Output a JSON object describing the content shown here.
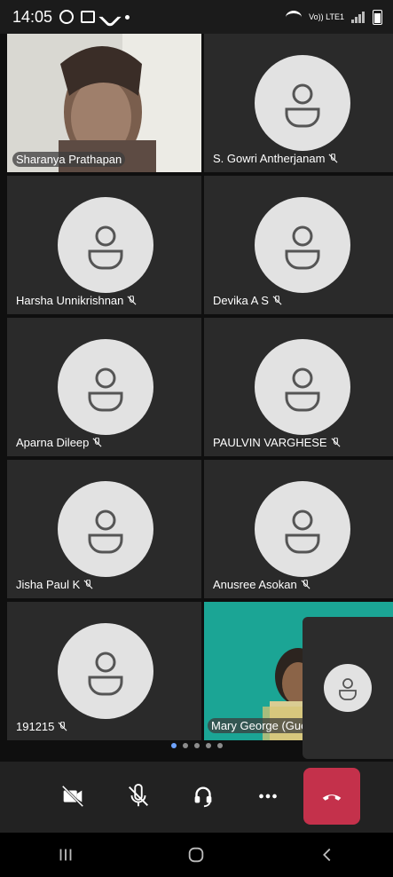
{
  "status_bar": {
    "time": "14:05",
    "network_label": "Vo)) LTE1"
  },
  "participants": [
    {
      "name": "Sharanya Prathapan",
      "muted": false,
      "video": true
    },
    {
      "name": "S. Gowri Antherjanam",
      "muted": true,
      "video": false
    },
    {
      "name": "Harsha Unnikrishnan",
      "muted": true,
      "video": false
    },
    {
      "name": "Devika A S",
      "muted": true,
      "video": false
    },
    {
      "name": "Aparna Dileep",
      "muted": true,
      "video": false
    },
    {
      "name": "PAULVIN VARGHESE",
      "muted": true,
      "video": false
    },
    {
      "name": "Jisha Paul K",
      "muted": true,
      "video": false
    },
    {
      "name": "Anusree Asokan",
      "muted": true,
      "video": false
    },
    {
      "name": "191215",
      "muted": true,
      "video": false
    },
    {
      "name": "Mary George (Gue",
      "muted": false,
      "video": true
    }
  ],
  "controls": {
    "camera_state": "off",
    "mic_state": "muted",
    "audio_device": "headset",
    "more_label": "More",
    "end_call_label": "Leave"
  },
  "pager": {
    "count": 5,
    "active_index": 0
  },
  "colors": {
    "background": "#0f0f0f",
    "tile": "#2a2a2a",
    "avatar": "#e2e2e2",
    "end_call": "#c4314b",
    "active_dot": "#6ea3ff"
  }
}
